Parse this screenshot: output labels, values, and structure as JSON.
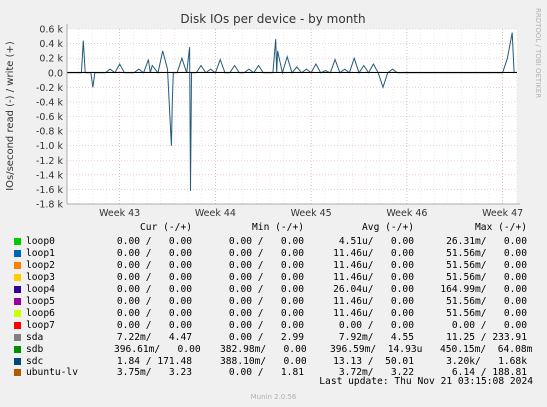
{
  "chart_data": {
    "type": "line",
    "title": "Disk IOs per device - by month",
    "ylabel": "IOs/second read (-) / write (+)",
    "ylim": [
      -1.8,
      0.6
    ],
    "y_ticks": [
      "0.6 k",
      "0.4 k",
      "0.2 k",
      "0.0",
      "-0.2 k",
      "-0.4 k",
      "-0.6 k",
      "-0.8 k",
      "-1.0 k",
      "-1.2 k",
      "-1.4 k",
      "-1.6 k",
      "-1.8 k"
    ],
    "y_tick_values": [
      0.6,
      0.4,
      0.2,
      0.0,
      -0.2,
      -0.4,
      -0.6,
      -0.8,
      -1.0,
      -1.2,
      -1.4,
      -1.6,
      -1.8
    ],
    "x_ticks": [
      "Week 43",
      "Week 44",
      "Week 45",
      "Week 46",
      "Week 47"
    ],
    "x_tick_values": [
      43,
      44,
      45,
      46,
      47
    ],
    "xlim": [
      42.45,
      47.15
    ],
    "grid": true,
    "side_text": "RRDTOOL / TOBI OETIKER",
    "series_sdc": {
      "name": "sdc",
      "color": "#235a7c",
      "x": [
        42.45,
        42.6,
        42.62,
        42.64,
        42.7,
        42.72,
        42.74,
        42.8,
        42.85,
        42.9,
        42.95,
        43.0,
        43.05,
        43.1,
        43.15,
        43.2,
        43.25,
        43.3,
        43.32,
        43.34,
        43.4,
        43.45,
        43.5,
        43.54,
        43.55,
        43.56,
        43.6,
        43.65,
        43.7,
        43.73,
        43.74,
        43.75,
        43.8,
        43.85,
        43.9,
        43.95,
        44.0,
        44.05,
        44.1,
        44.15,
        44.2,
        44.25,
        44.3,
        44.35,
        44.4,
        44.45,
        44.5,
        44.55,
        44.6,
        44.63,
        44.64,
        44.65,
        44.7,
        44.75,
        44.8,
        44.85,
        44.9,
        44.95,
        45.0,
        45.05,
        45.1,
        45.15,
        45.2,
        45.25,
        45.3,
        45.35,
        45.4,
        45.45,
        45.5,
        45.55,
        45.6,
        45.65,
        45.7,
        45.75,
        45.8,
        45.85,
        45.9,
        45.95,
        46.0,
        46.05,
        46.1,
        46.15,
        46.2,
        46.25,
        46.3,
        46.35,
        46.4,
        46.45,
        46.5,
        46.55,
        46.6,
        46.65,
        46.7,
        46.75,
        46.8,
        46.85,
        46.9,
        46.95,
        47.0,
        47.05,
        47.1,
        47.12
      ],
      "y": [
        0.0,
        0.0,
        0.44,
        0.0,
        0.0,
        -0.2,
        0.0,
        0.0,
        0.0,
        0.05,
        0.0,
        0.12,
        0.0,
        0.0,
        0.0,
        0.05,
        0.0,
        0.18,
        0.0,
        0.1,
        0.0,
        0.3,
        0.05,
        -1.0,
        -0.4,
        0.0,
        0.0,
        0.2,
        0.0,
        0.35,
        -1.62,
        0.0,
        0.0,
        0.1,
        0.0,
        0.05,
        0.0,
        0.18,
        0.0,
        0.0,
        0.1,
        0.0,
        0.0,
        0.05,
        0.0,
        0.1,
        0.0,
        0.0,
        0.0,
        0.46,
        0.0,
        0.3,
        0.0,
        0.22,
        0.0,
        0.08,
        0.0,
        0.05,
        0.0,
        0.12,
        0.0,
        0.03,
        0.0,
        0.18,
        0.0,
        0.05,
        0.0,
        0.2,
        0.0,
        0.1,
        0.0,
        0.12,
        0.0,
        -0.2,
        0.0,
        0.05,
        0.0,
        0.0,
        0.0,
        0.0,
        0.0,
        0.0,
        0.0,
        0.0,
        0.0,
        0.0,
        0.0,
        0.0,
        0.0,
        0.0,
        0.0,
        0.0,
        0.0,
        0.0,
        0.0,
        0.0,
        0.0,
        0.0,
        0.0,
        0.2,
        0.55,
        0.0
      ]
    },
    "series_sda": {
      "name": "sda",
      "color": "#cc7700",
      "x": [
        42.45,
        47.15
      ],
      "y": [
        0.005,
        0.005
      ]
    }
  },
  "legend": {
    "headers": {
      "cur": "Cur (-/+)",
      "min": "Min (-/+)",
      "avg": "Avg (-/+)",
      "max": "Max (-/+)"
    },
    "rows": [
      {
        "name": "loop0",
        "color": "#00cc00",
        "cur": "0.00 /   0.00",
        "min": "0.00 /   0.00",
        "avg": "4.51u/   0.00",
        "max": "26.31m/   0.00"
      },
      {
        "name": "loop1",
        "color": "#0066b3",
        "cur": "0.00 /   0.00",
        "min": "0.00 /   0.00",
        "avg": "11.46u/   0.00",
        "max": "51.56m/   0.00"
      },
      {
        "name": "loop2",
        "color": "#ff8000",
        "cur": "0.00 /   0.00",
        "min": "0.00 /   0.00",
        "avg": "11.46u/   0.00",
        "max": "51.56m/   0.00"
      },
      {
        "name": "loop3",
        "color": "#ffcc00",
        "cur": "0.00 /   0.00",
        "min": "0.00 /   0.00",
        "avg": "11.46u/   0.00",
        "max": "51.56m/   0.00"
      },
      {
        "name": "loop4",
        "color": "#330099",
        "cur": "0.00 /   0.00",
        "min": "0.00 /   0.00",
        "avg": "26.04u/   0.00",
        "max": "164.99m/   0.00"
      },
      {
        "name": "loop5",
        "color": "#990099",
        "cur": "0.00 /   0.00",
        "min": "0.00 /   0.00",
        "avg": "11.46u/   0.00",
        "max": "51.56m/   0.00"
      },
      {
        "name": "loop6",
        "color": "#ccff00",
        "cur": "0.00 /   0.00",
        "min": "0.00 /   0.00",
        "avg": "11.46u/   0.00",
        "max": "51.56m/   0.00"
      },
      {
        "name": "loop7",
        "color": "#ff0000",
        "cur": "0.00 /   0.00",
        "min": "0.00 /   0.00",
        "avg": "0.00 /   0.00",
        "max": "0.00 /   0.00"
      },
      {
        "name": "sda",
        "color": "#808080",
        "cur": "7.22m/   4.47",
        "min": "0.00 /   2.99",
        "avg": "7.92m/   4.55",
        "max": "11.25 / 233.91"
      },
      {
        "name": "sdb",
        "color": "#008f00",
        "cur": "396.61m/   0.00",
        "min": "382.98m/   0.00",
        "avg": "396.59m/  14.93u",
        "max": "450.15m/  64.08m"
      },
      {
        "name": "sdc",
        "color": "#00487d",
        "cur": "1.84 / 171.48",
        "min": "388.10m/   0.00",
        "avg": "13.13 /  50.01",
        "max": "3.20k/   1.68k"
      },
      {
        "name": "ubuntu-lv",
        "color": "#b35a00",
        "cur": "3.75m/   3.23",
        "min": "0.00 /   1.81",
        "avg": "3.72m/   3.22",
        "max": "6.14 / 188.81"
      }
    ]
  },
  "last_update": "Last update:  Thu Nov 21 03:15:08 2024",
  "footer": "Munin 2.0.56"
}
